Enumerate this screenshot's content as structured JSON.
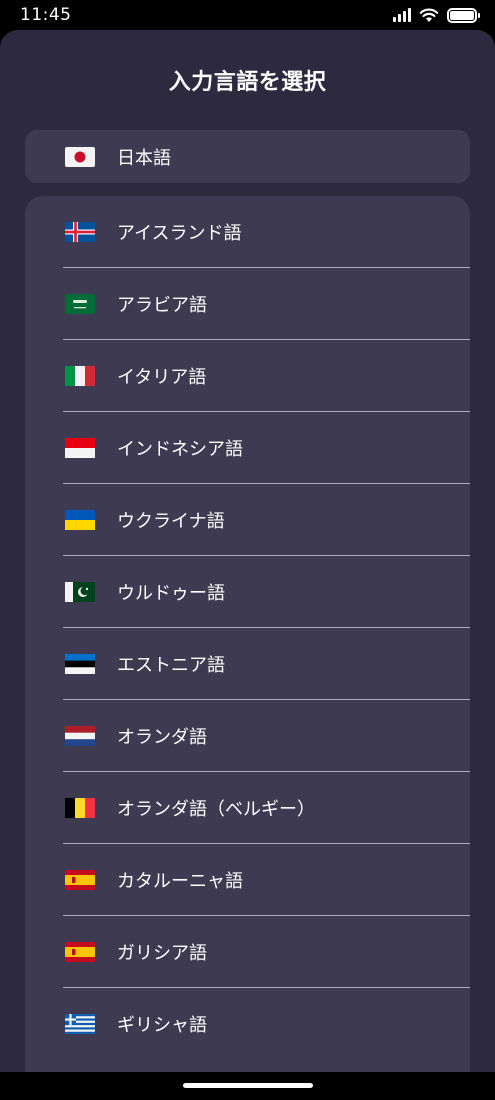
{
  "status_bar": {
    "time": "11:45",
    "icons": [
      "cellular-signal-icon",
      "wifi-icon",
      "battery-icon"
    ],
    "battery_level": 1.0
  },
  "title": "入力言語を選択",
  "selected_language": {
    "label": "日本語",
    "flag": "japan-flag-icon"
  },
  "languages": [
    {
      "label": "アイスランド語",
      "flag": "iceland-flag-icon"
    },
    {
      "label": "アラビア語",
      "flag": "saudi-arabia-flag-icon"
    },
    {
      "label": "イタリア語",
      "flag": "italy-flag-icon"
    },
    {
      "label": "インドネシア語",
      "flag": "indonesia-flag-icon"
    },
    {
      "label": "ウクライナ語",
      "flag": "ukraine-flag-icon"
    },
    {
      "label": "ウルドゥー語",
      "flag": "pakistan-flag-icon"
    },
    {
      "label": "エストニア語",
      "flag": "estonia-flag-icon"
    },
    {
      "label": "オランダ語",
      "flag": "netherlands-flag-icon"
    },
    {
      "label": "オランダ語（ベルギー）",
      "flag": "belgium-flag-icon"
    },
    {
      "label": "カタルーニャ語",
      "flag": "spain-flag-icon"
    },
    {
      "label": "ガリシア語",
      "flag": "spain-flag-icon"
    },
    {
      "label": "ギリシャ語",
      "flag": "greece-flag-icon"
    }
  ],
  "colors": {
    "sheet_background": "#2d2a40",
    "card_background": "#3e3a51",
    "divider": "#c9c7d2"
  }
}
